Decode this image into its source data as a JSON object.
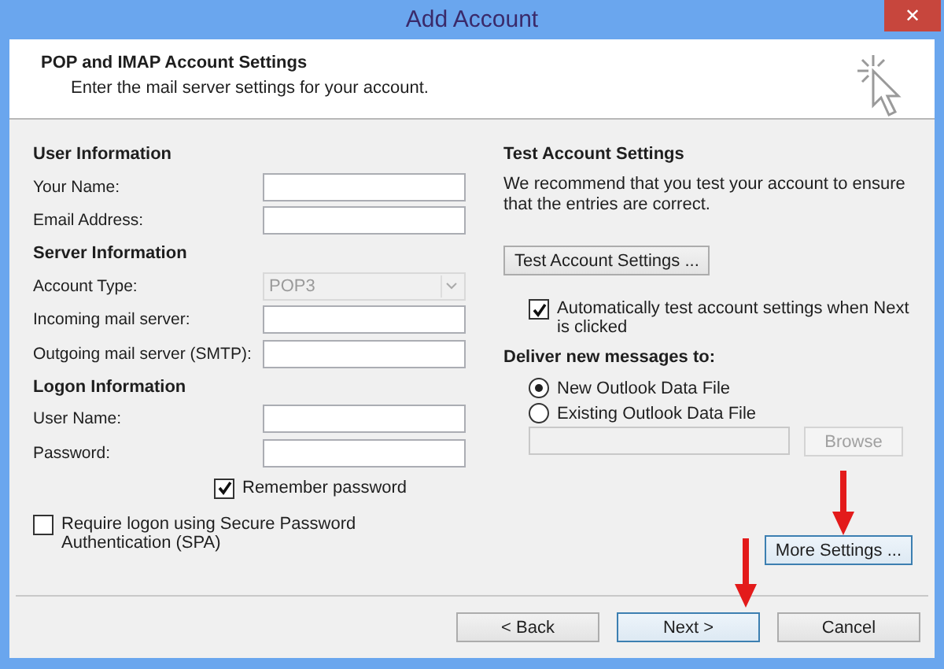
{
  "window": {
    "title": "Add Account",
    "close_label": "✕"
  },
  "header": {
    "title": "POP and IMAP Account Settings",
    "subtitle": "Enter the mail server settings for your account."
  },
  "left_sections": [
    {
      "heading": "User Information",
      "fields": [
        {
          "label": "Your Name:",
          "kind": "text"
        },
        {
          "label": "Email Address:",
          "kind": "text"
        }
      ]
    },
    {
      "heading": "Server Information",
      "fields": [
        {
          "label": "Account Type:",
          "kind": "dropdown",
          "value": "POP3",
          "disabled": true
        },
        {
          "label": "Incoming mail server:",
          "kind": "text"
        },
        {
          "label": "Outgoing mail server (SMTP):",
          "kind": "text"
        }
      ]
    },
    {
      "heading": "Logon Information",
      "fields": [
        {
          "label": "User Name:",
          "kind": "text"
        },
        {
          "label": "Password:",
          "kind": "text"
        }
      ]
    }
  ],
  "remember_password": {
    "label": "Remember password",
    "checked": true
  },
  "require_spa": {
    "label": "Require logon using Secure Password Authentication (SPA)",
    "checked": false
  },
  "test": {
    "heading": "Test Account Settings",
    "description": "We recommend that you test your account to ensure that the entries are correct.",
    "button": "Test Account Settings ...",
    "auto_test": {
      "label": "Automatically test account settings when Next is clicked",
      "checked": true
    }
  },
  "deliver": {
    "heading": "Deliver new messages to:",
    "options": [
      {
        "label": "New Outlook Data File",
        "selected": true
      },
      {
        "label": "Existing Outlook Data File",
        "selected": false
      }
    ],
    "browse": {
      "label": "Browse",
      "disabled": true
    },
    "more_settings": "More Settings ..."
  },
  "footer_buttons": [
    {
      "label": "< Back",
      "focused": false
    },
    {
      "label": "Next >",
      "focused": true
    },
    {
      "label": "Cancel",
      "focused": false
    }
  ]
}
